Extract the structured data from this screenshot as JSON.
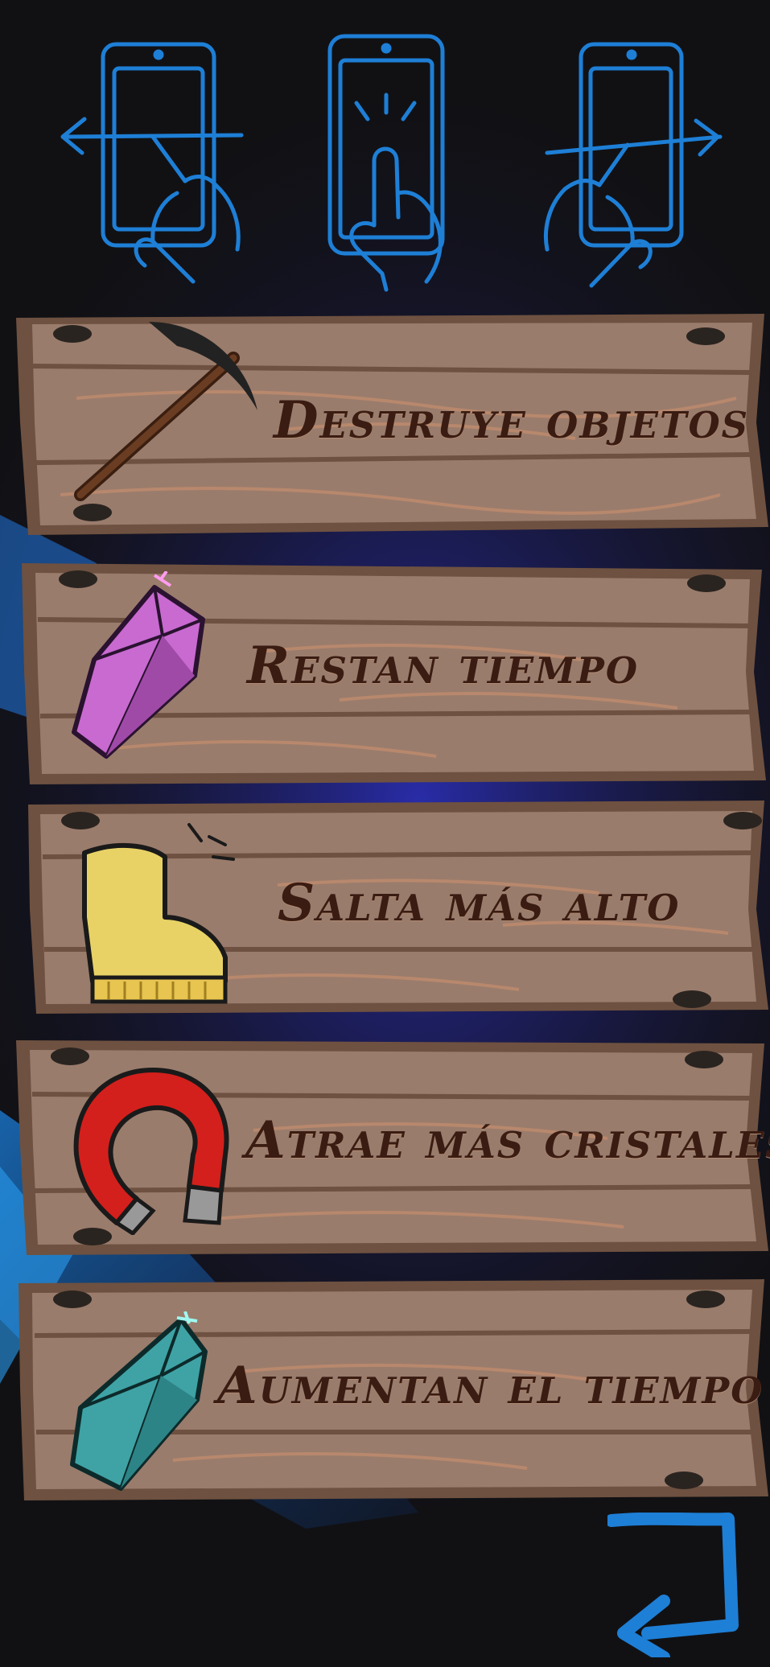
{
  "gestures": [
    {
      "name": "swipe-left",
      "icon": "phone-swipe-left-icon"
    },
    {
      "name": "tap-jump",
      "icon": "phone-tap-icon"
    },
    {
      "name": "swipe-right",
      "icon": "phone-swipe-right-icon"
    }
  ],
  "items": [
    {
      "label": "Destruye objetos",
      "icon": "pickaxe-icon"
    },
    {
      "label": "Restan  tiempo",
      "icon": "pink-crystal-icon"
    },
    {
      "label": "Salta más alto",
      "icon": "boot-icon"
    },
    {
      "label": "Atrae más cristales",
      "icon": "magnet-icon"
    },
    {
      "label": "Aumentan el tiempo",
      "icon": "teal-crystal-icon"
    }
  ],
  "colors": {
    "background": "#111114",
    "accent_blue": "#1e7fd6",
    "wood": "#9a7c6c",
    "wood_edge": "#6e5140",
    "text": "#3a1c12"
  },
  "back_button": {
    "icon": "return-arrow-icon"
  }
}
